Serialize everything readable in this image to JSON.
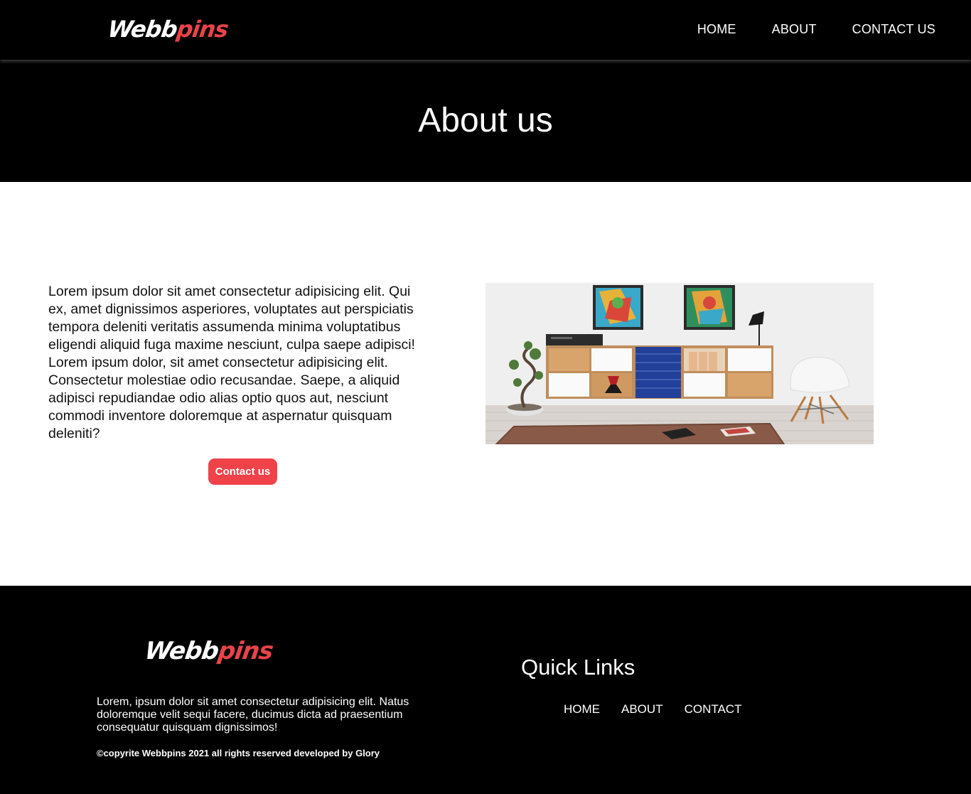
{
  "header": {
    "logo": {
      "part1": "Webb",
      "part2": "pins"
    },
    "nav": [
      "HOME",
      "ABOUT",
      "CONTACT US"
    ]
  },
  "hero": {
    "title": "About us"
  },
  "main": {
    "paragraph": "Lorem ipsum dolor sit amet consectetur adipisicing elit. Qui ex, amet dignissimos asperiores, voluptates aut perspiciatis tempora deleniti veritatis assumenda minima voluptatibus eligendi aliquid fuga maxime nesciunt, culpa saepe adipisci! Lorem ipsum dolor, sit amet consectetur adipisicing elit. Consectetur molestiae odio recusandae. Saepe, a aliquid adipisci repudiandae odio alias optio quos aut, nesciunt commodi inventore doloremque at aspernatur quisquam deleniti?",
    "cta_label": "Contact us"
  },
  "footer": {
    "logo": {
      "part1": "Webb",
      "part2": "pins"
    },
    "text": "Lorem, ipsum dolor sit amet consectetur adipisicing elit. Natus doloremque velit sequi facere, ducimus dicta ad praesentium consequatur quisquam dignissimos!",
    "copyright": "©copyrite Webbpins 2021 all rights reserved developed by Glory",
    "quick_links_title": "Quick Links",
    "links": [
      "HOME",
      "ABOUT",
      "CONTACT"
    ]
  },
  "colors": {
    "brand_red": "#ef4249",
    "background_dark": "#000000"
  }
}
